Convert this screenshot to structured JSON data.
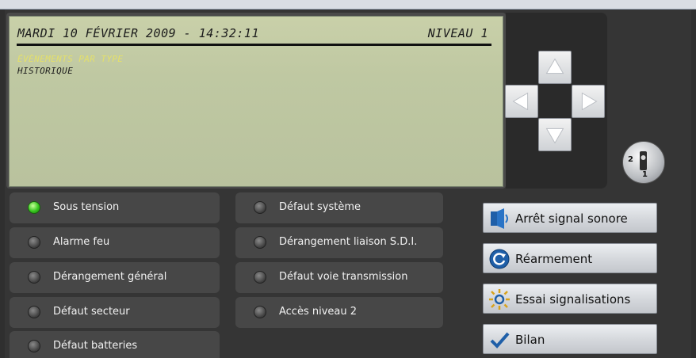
{
  "display": {
    "datetime": "MARDI 10 FÉVRIER 2009 - 14:32:11",
    "level": "NIVEAU 1",
    "menu_selected": "ÉVÈNEMENTS PAR TYPE",
    "menu_item": "HISTORIQUE",
    "selected_color": "#e4e06a"
  },
  "key_switch": {
    "pos_a": "2",
    "pos_b": "1"
  },
  "indicators_left": [
    {
      "label": "Sous tension",
      "state": "on"
    },
    {
      "label": "Alarme feu",
      "state": "off"
    },
    {
      "label": "Dérangement général",
      "state": "off"
    },
    {
      "label": "Défaut secteur",
      "state": "off"
    },
    {
      "label": "Défaut batteries",
      "state": "off"
    }
  ],
  "indicators_right": [
    {
      "label": "Défaut système",
      "state": "off"
    },
    {
      "label": "Dérangement liaison S.D.I.",
      "state": "off"
    },
    {
      "label": "Défaut voie transmission",
      "state": "off"
    },
    {
      "label": "Accès niveau 2",
      "state": "off"
    }
  ],
  "buttons": [
    {
      "label": "Arrêt signal sonore",
      "icon": "speaker-icon"
    },
    {
      "label": "Réarmement",
      "icon": "reset-icon"
    },
    {
      "label": "Essai signalisations",
      "icon": "light-test-icon"
    },
    {
      "label": "Bilan",
      "icon": "checkmark-icon"
    }
  ],
  "colors": {
    "led_on": "#36c51e",
    "led_off": "#5a5a5a",
    "panel": "#353535"
  }
}
